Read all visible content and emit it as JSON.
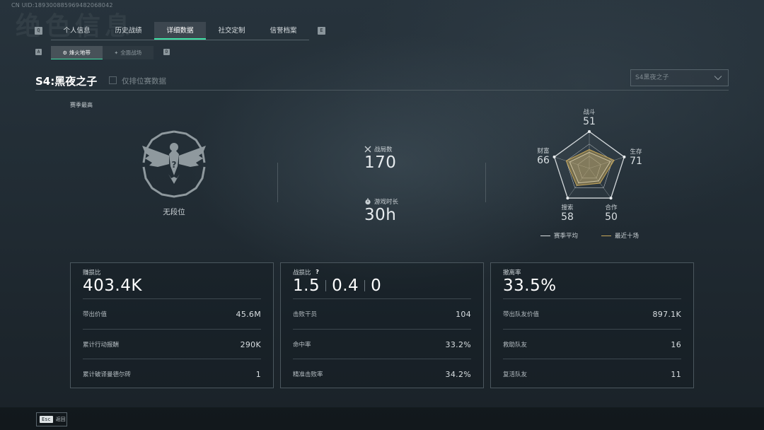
{
  "uid": "CN UID:18930088596948206804​2",
  "background_title": "绝色信息",
  "tabs": {
    "prev_key": "Q",
    "next_key": "E",
    "items": [
      "个人信息",
      "历史战绩",
      "详细数据",
      "社交定制",
      "信誉档案"
    ],
    "active_index": 2
  },
  "subtabs": {
    "prev_key": "A",
    "next_key": "D",
    "items": [
      "烽火地带",
      "全面战场"
    ],
    "active_index": 0
  },
  "season": {
    "title": "S4:黑夜之子",
    "ranked_only_label": "仅排位赛数据",
    "ranked_only_checked": false,
    "selector_value": "S4黑夜之子"
  },
  "overview": {
    "season_best_label": "赛季最高",
    "rank_name": "无段位",
    "matches_label": "战局数",
    "matches_value": "170",
    "playtime_label": "游戏时长",
    "playtime_value": "30h"
  },
  "radar": {
    "axes": [
      {
        "label": "战斗",
        "value": "51"
      },
      {
        "label": "生存",
        "value": "71"
      },
      {
        "label": "合作",
        "value": "50"
      },
      {
        "label": "搜索",
        "value": "58"
      },
      {
        "label": "财富",
        "value": "66"
      }
    ],
    "legend_avg": "赛季平均",
    "legend_recent": "最近十场",
    "avg_color": "#d8dde0",
    "recent_color": "#c8a85a"
  },
  "cards": {
    "profit": {
      "label": "赚损比",
      "value": "403.4K",
      "rows": [
        {
          "k": "带出价值",
          "v": "45.6M"
        },
        {
          "k": "累计行动报酬",
          "v": "290K"
        },
        {
          "k": "累计破译曼德尔砖",
          "v": "1"
        }
      ]
    },
    "kd": {
      "label": "战损比",
      "help": "?",
      "values": [
        "1.5",
        "0.4",
        "0"
      ],
      "rows": [
        {
          "k": "击败干员",
          "v": "104"
        },
        {
          "k": "命中率",
          "v": "33.2%"
        },
        {
          "k": "精准击败率",
          "v": "34.2%"
        }
      ]
    },
    "extract": {
      "label": "撤离率",
      "value": "33.5%",
      "rows": [
        {
          "k": "带出队友价值",
          "v": "897.1K"
        },
        {
          "k": "救助队友",
          "v": "16"
        },
        {
          "k": "复活队友",
          "v": "11"
        }
      ]
    }
  },
  "footer": {
    "esc_key": "Esc",
    "back_label": "返回"
  },
  "colors": {
    "accent": "#3fe0a5",
    "text": "#c9d0d4",
    "border": "#4b575e"
  }
}
